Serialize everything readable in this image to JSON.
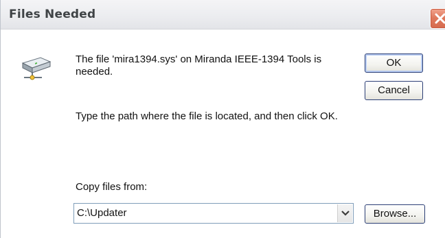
{
  "window": {
    "title": "Files Needed"
  },
  "message": {
    "line1": "The file 'mira1394.sys' on Miranda IEEE-1394 Tools is needed.",
    "line2": "Type the path where the file is located, and then click OK."
  },
  "buttons": {
    "ok": "OK",
    "cancel": "Cancel",
    "browse": "Browse..."
  },
  "copy_from": {
    "label": "Copy files from:",
    "value": "C:\\Updater"
  },
  "icons": {
    "close": "close-icon",
    "drive": "network-drive-icon",
    "dropdown": "chevron-down-icon"
  }
}
